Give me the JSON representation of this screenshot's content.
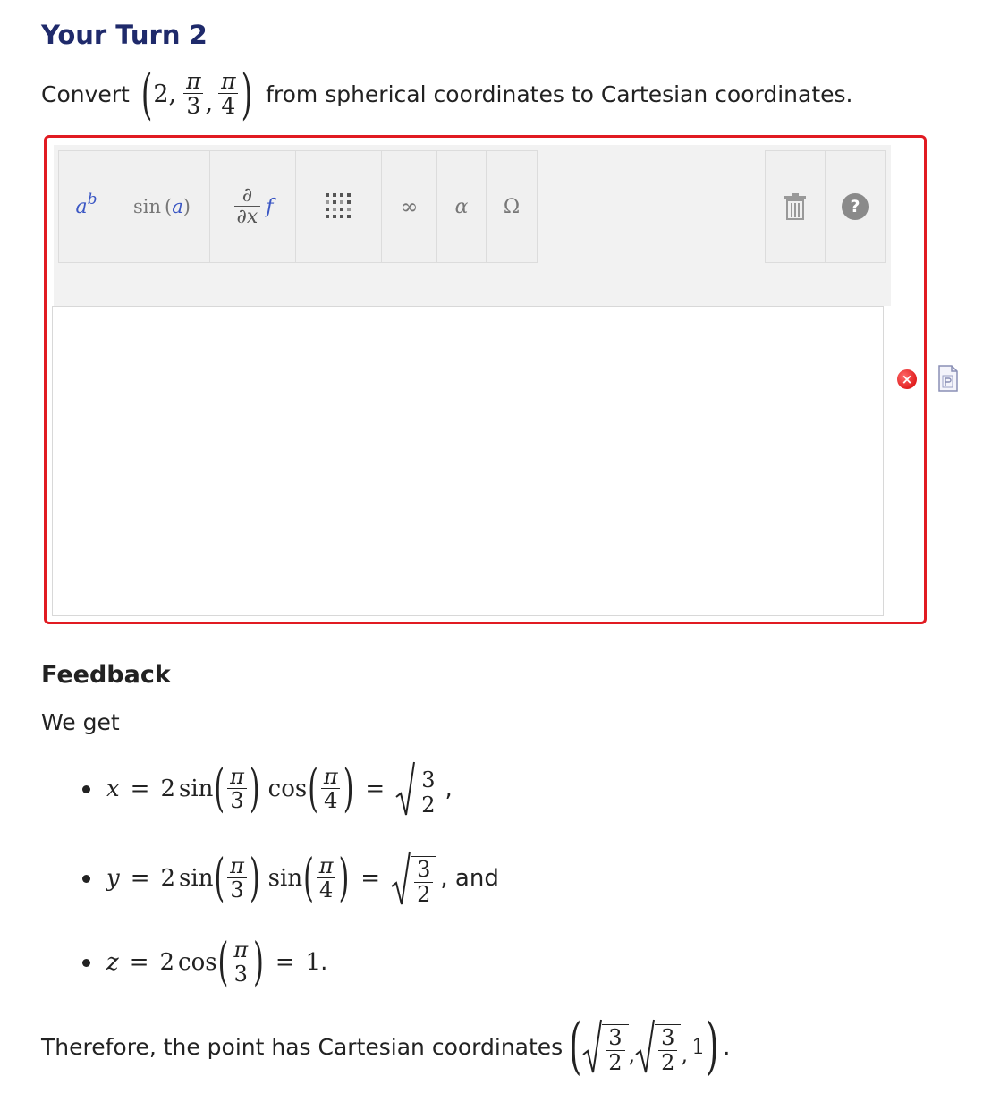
{
  "title": "Your Turn 2",
  "prompt": {
    "before": "Convert",
    "point_open": "(",
    "rho": "2,",
    "theta_num": "π",
    "theta_den": "3",
    "comma": ",",
    "phi_num": "π",
    "phi_den": "4",
    "point_close": ")",
    "after": "from spherical coordinates to Cartesian coordinates."
  },
  "toolbar": {
    "btn_power_base": "a",
    "btn_power_exp": "b",
    "btn_trig_fn": "sin",
    "btn_trig_arg": "a",
    "btn_deriv_num": "∂",
    "btn_deriv_den": "∂x",
    "btn_deriv_f": "f",
    "btn_infinity": "∞",
    "btn_alpha": "α",
    "btn_omega": "Ω",
    "btn_help": "?"
  },
  "input": {
    "value": ""
  },
  "status": {
    "error_symbol": "×"
  },
  "feedback": {
    "heading": "Feedback",
    "intro": "We get",
    "line1": {
      "var": "x",
      "eq": "=",
      "coef": "2",
      "fn1": "sin",
      "a_num": "π",
      "a_den": "3",
      "fn2": "cos",
      "b_num": "π",
      "b_den": "4",
      "eq2": "=",
      "r_num": "3",
      "r_den": "2",
      "tail": ","
    },
    "line2": {
      "var": "y",
      "eq": "=",
      "coef": "2",
      "fn1": "sin",
      "a_num": "π",
      "a_den": "3",
      "fn2": "sin",
      "b_num": "π",
      "b_den": "4",
      "eq2": "=",
      "r_num": "3",
      "r_den": "2",
      "tail": ", and"
    },
    "line3": {
      "var": "z",
      "eq": "=",
      "coef": "2",
      "fn1": "cos",
      "a_num": "π",
      "a_den": "3",
      "eq2": "=",
      "result": "1",
      "tail": "."
    },
    "conclusion": {
      "text": "Therefore, the point has Cartesian coordinates",
      "x_num": "3",
      "x_den": "2",
      "y_num": "3",
      "y_den": "2",
      "z": "1",
      "tail": "."
    }
  }
}
